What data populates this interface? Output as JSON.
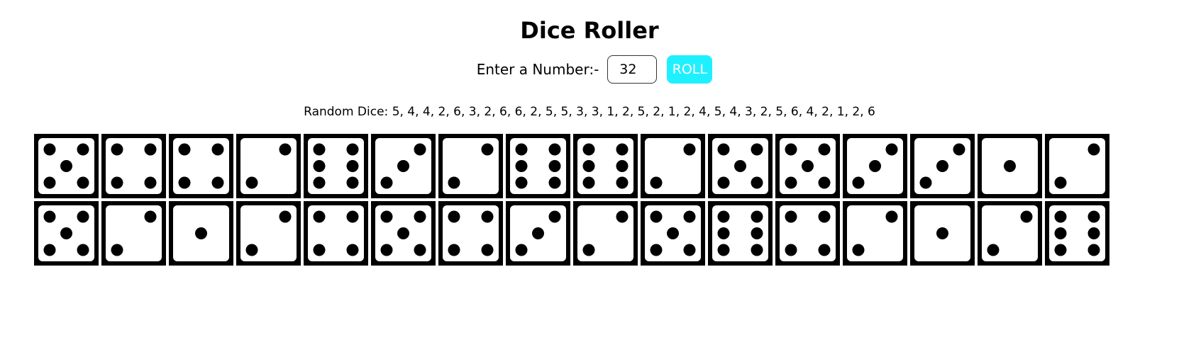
{
  "page": {
    "title": "Dice Roller"
  },
  "controls": {
    "prompt_label": "Enter a Number:-",
    "number_value": "32",
    "roll_label": "ROLL",
    "roll_color": "#1ff0ff"
  },
  "result": {
    "label": "Random Dice:",
    "values_text": "5, 4, 4, 2, 6, 3, 2, 6, 6, 2, 5, 5, 3, 3, 1, 2, 5, 2, 1, 2, 4, 5, 4, 3, 2, 5, 6, 4, 2, 1, 2, 6"
  },
  "dice": [
    5,
    4,
    4,
    2,
    6,
    3,
    2,
    6,
    6,
    2,
    5,
    5,
    3,
    3,
    1,
    2,
    5,
    2,
    1,
    2,
    4,
    5,
    4,
    3,
    2,
    5,
    6,
    4,
    2,
    1,
    2,
    6
  ],
  "colors": {
    "die_face": "#000000",
    "die_inner": "#ffffff",
    "pip": "#000000"
  }
}
